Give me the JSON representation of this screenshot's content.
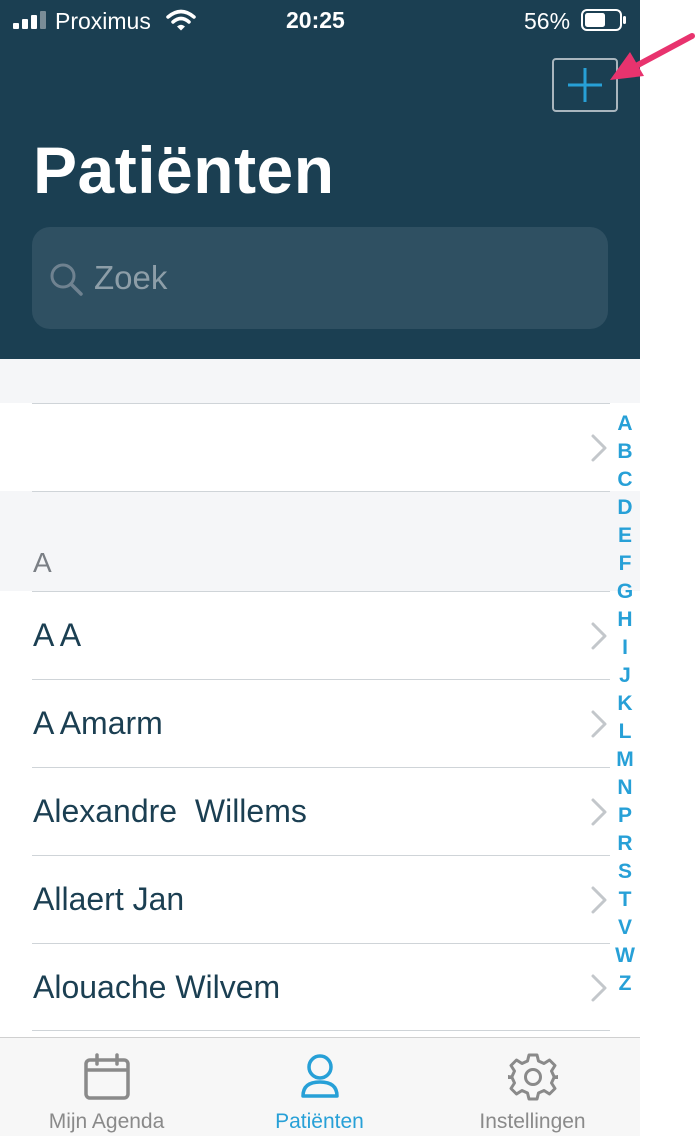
{
  "status_bar": {
    "carrier": "Proximus",
    "time": "20:25",
    "battery": "56%"
  },
  "header": {
    "title": "Patiënten",
    "add_icon": "plus-icon"
  },
  "search": {
    "placeholder": "Zoek",
    "icon": "search-icon"
  },
  "list": {
    "top_row_name": "",
    "section_a_label": "A",
    "rows": [
      "A A",
      "A Amarm",
      "Alexandre  Willems",
      "Allaert Jan",
      "Alouache Wilvem"
    ]
  },
  "index_letters": [
    "A",
    "B",
    "C",
    "D",
    "E",
    "F",
    "G",
    "H",
    "I",
    "J",
    "K",
    "L",
    "M",
    "N",
    "P",
    "R",
    "S",
    "T",
    "V",
    "W",
    "Z"
  ],
  "tabbar": {
    "tabs": [
      {
        "label": "Mijn Agenda",
        "icon": "calendar-icon"
      },
      {
        "label": "Patiënten",
        "icon": "person-icon"
      },
      {
        "label": "Instellingen",
        "icon": "gear-icon"
      }
    ],
    "active": "Patiënten"
  },
  "colors": {
    "header_bg": "#1b3f52",
    "accent": "#27a0d7",
    "annotation_arrow": "#e8336e"
  }
}
